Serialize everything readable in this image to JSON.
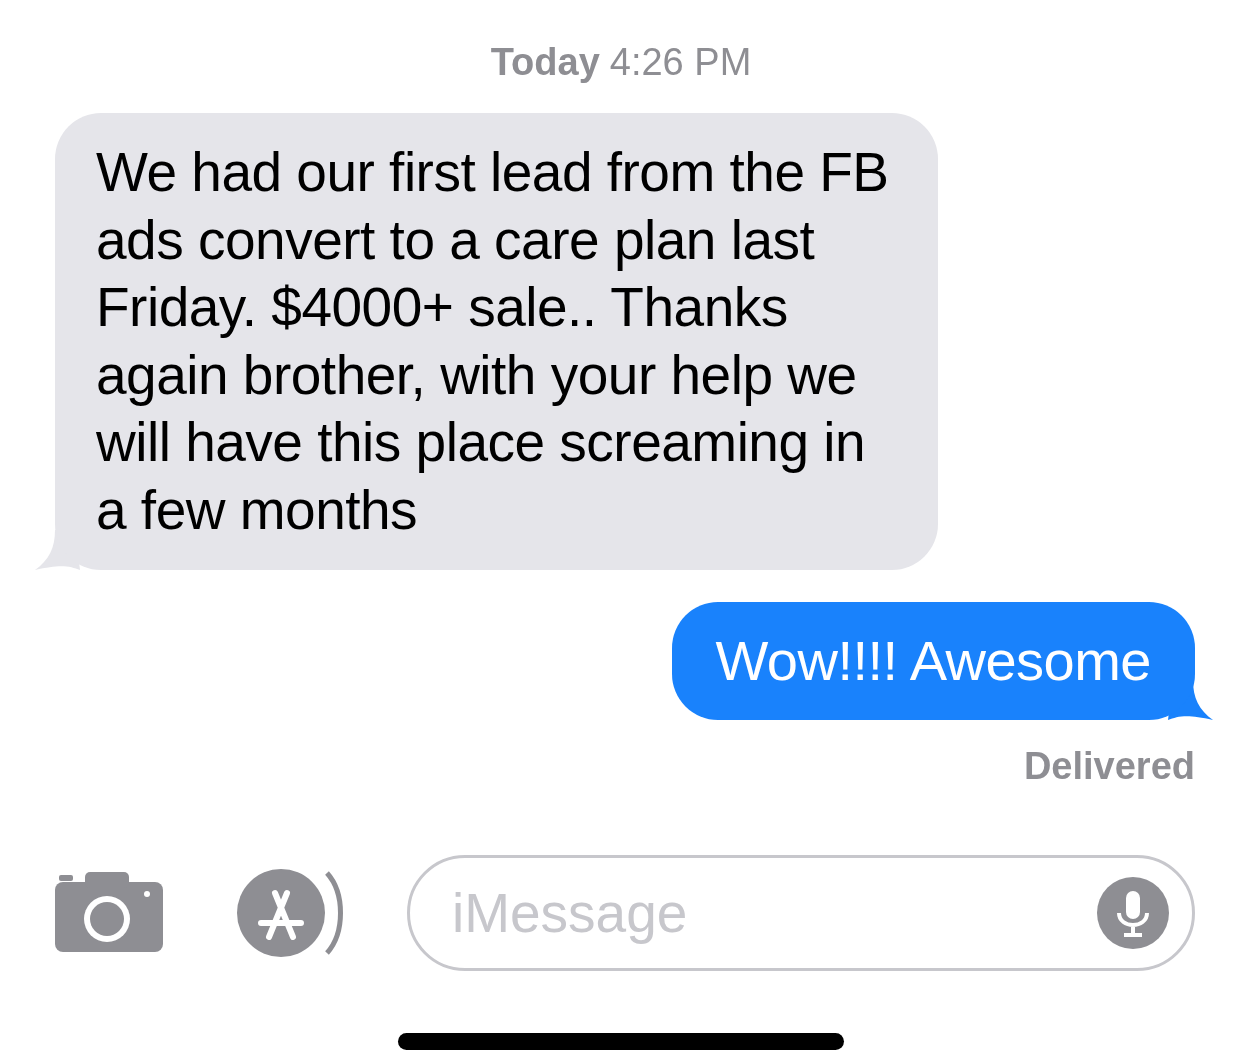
{
  "timestamp": {
    "day": "Today",
    "time": "4:26 PM"
  },
  "messages": [
    {
      "kind": "received",
      "text": "We had our first lead from the FB ads convert to a care plan last Friday. $4000+ sale.. Thanks again brother, with your help we will have this place screaming in a few months"
    },
    {
      "kind": "sent",
      "text": "Wow!!!! Awesome"
    }
  ],
  "status": "Delivered",
  "composer": {
    "placeholder": "iMessage"
  }
}
